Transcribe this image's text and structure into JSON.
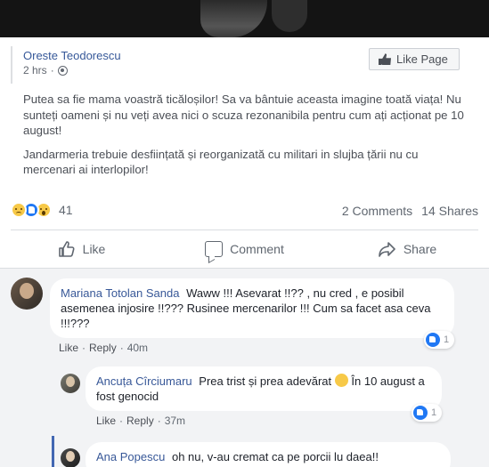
{
  "post": {
    "author": "Oreste Teodorescu",
    "time": "2 hrs",
    "like_page_label": "Like Page",
    "paragraph1": "Putea sa fie mama voastră ticăloșilor! Sa va bântuie aceasta imagine toată viața! Nu sunteți oameni și nu veți avea nici o scuza rezonanibila pentru cum ați acționat pe 10 august!",
    "paragraph2": "Jandarmeria trebuie desființată și reorganizată cu militari in slujba țării nu cu mercenari ai interlopilor!",
    "reaction_count": "41",
    "comments_count": "2 Comments",
    "shares_count": "14 Shares"
  },
  "actions": {
    "like": "Like",
    "comment": "Comment",
    "share": "Share"
  },
  "comments": [
    {
      "name": "Mariana Totolan Sanda",
      "text": "Waww !!! Asevarat !!?? , nu cred , e posibil asemenea injosire !!??? Rusinee mercenarilor !!! Cum sa facet asa ceva !!!???",
      "like": "Like",
      "reply": "Reply",
      "time": "40m",
      "reactions": "1"
    },
    {
      "name": "Ancuța Cîrciumaru",
      "text_before": "Prea trist și prea adevărat",
      "text_after": "În 10 august a fost genocid",
      "like": "Like",
      "reply": "Reply",
      "time": "37m",
      "reactions": "1"
    },
    {
      "name": "Ana Popescu",
      "text": "oh nu, v-au cremat ca pe porcii lu daea!!"
    }
  ],
  "colors": {
    "link": "#385898",
    "accent": "#4267b2",
    "comment_bg": "#f2f3f5"
  }
}
